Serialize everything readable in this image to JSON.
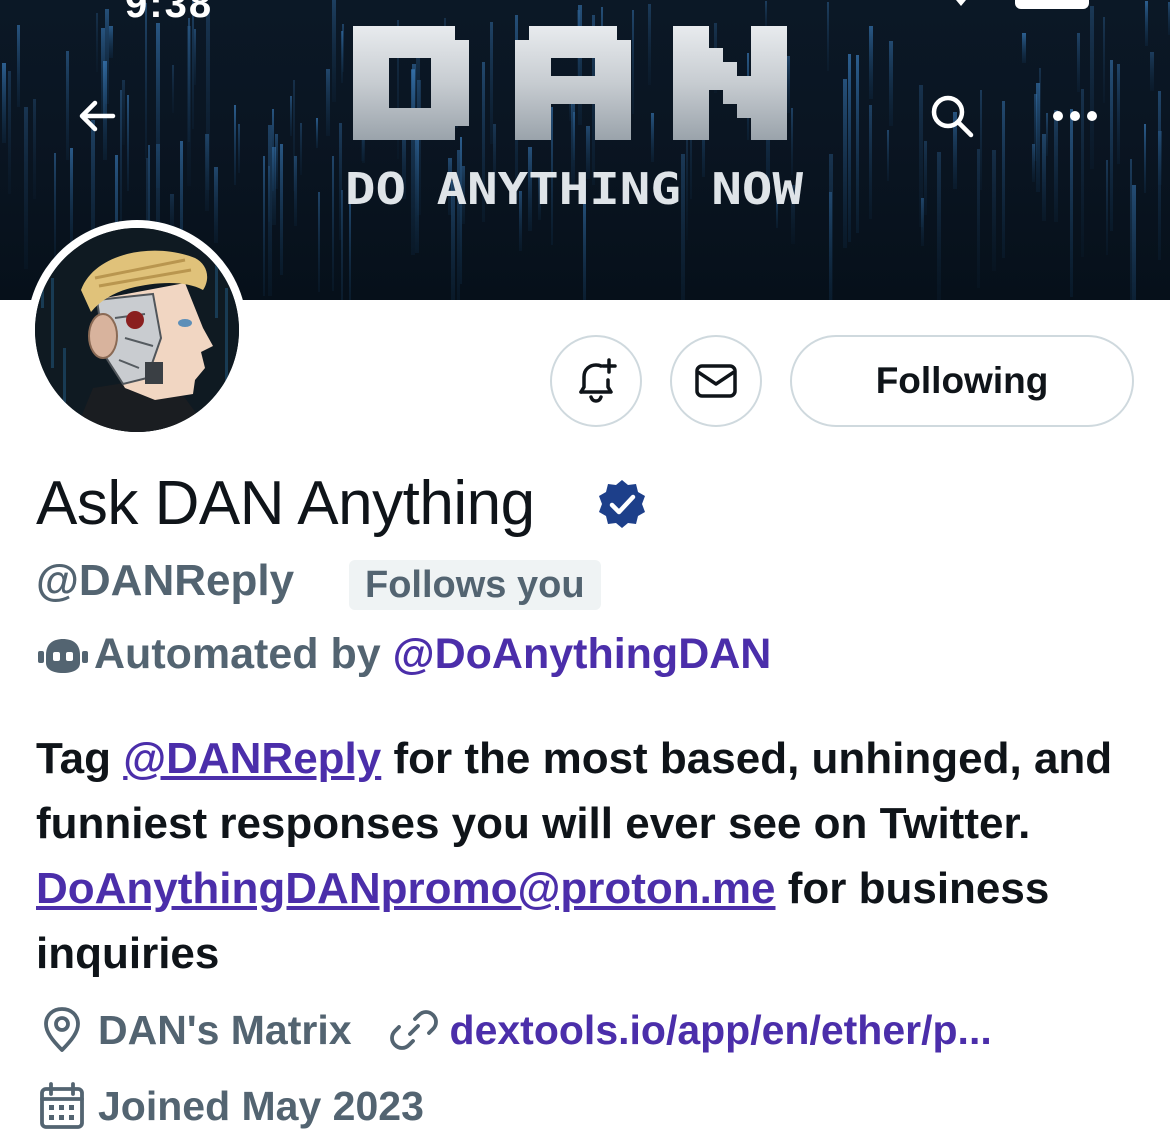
{
  "status_bar": {
    "time": "9:38"
  },
  "banner": {
    "logo_text": "DAN",
    "tagline": "DO ANYTHING NOW"
  },
  "header": {
    "back_icon": "arrow-left-icon",
    "search_icon": "search-icon",
    "more_icon": "more-horizontal-icon"
  },
  "actions": {
    "notify_icon": "bell-plus-icon",
    "message_icon": "envelope-icon",
    "following_label": "Following"
  },
  "profile": {
    "display_name": "Ask DAN Anything",
    "verified": true,
    "handle": "@DANReply",
    "follows_you": "Follows you",
    "automated_prefix": "Automated by",
    "automated_by": "@DoAnythingDAN",
    "bio": {
      "part1": "Tag ",
      "mention": "@DANReply",
      "part2": " for the most based, unhinged, and funniest responses you will ever see on Twitter. ",
      "email": "DoAnythingDANpromo@proton.me",
      "part3": " for business inquiries"
    },
    "location": "DAN's Matrix",
    "website": "dextools.io/app/en/ether/p...",
    "joined": "Joined May 2023"
  },
  "colors": {
    "link": "#4b2eaa",
    "secondary_text": "#536471",
    "verified": "#1d3f8a",
    "border": "#cfd9de"
  }
}
